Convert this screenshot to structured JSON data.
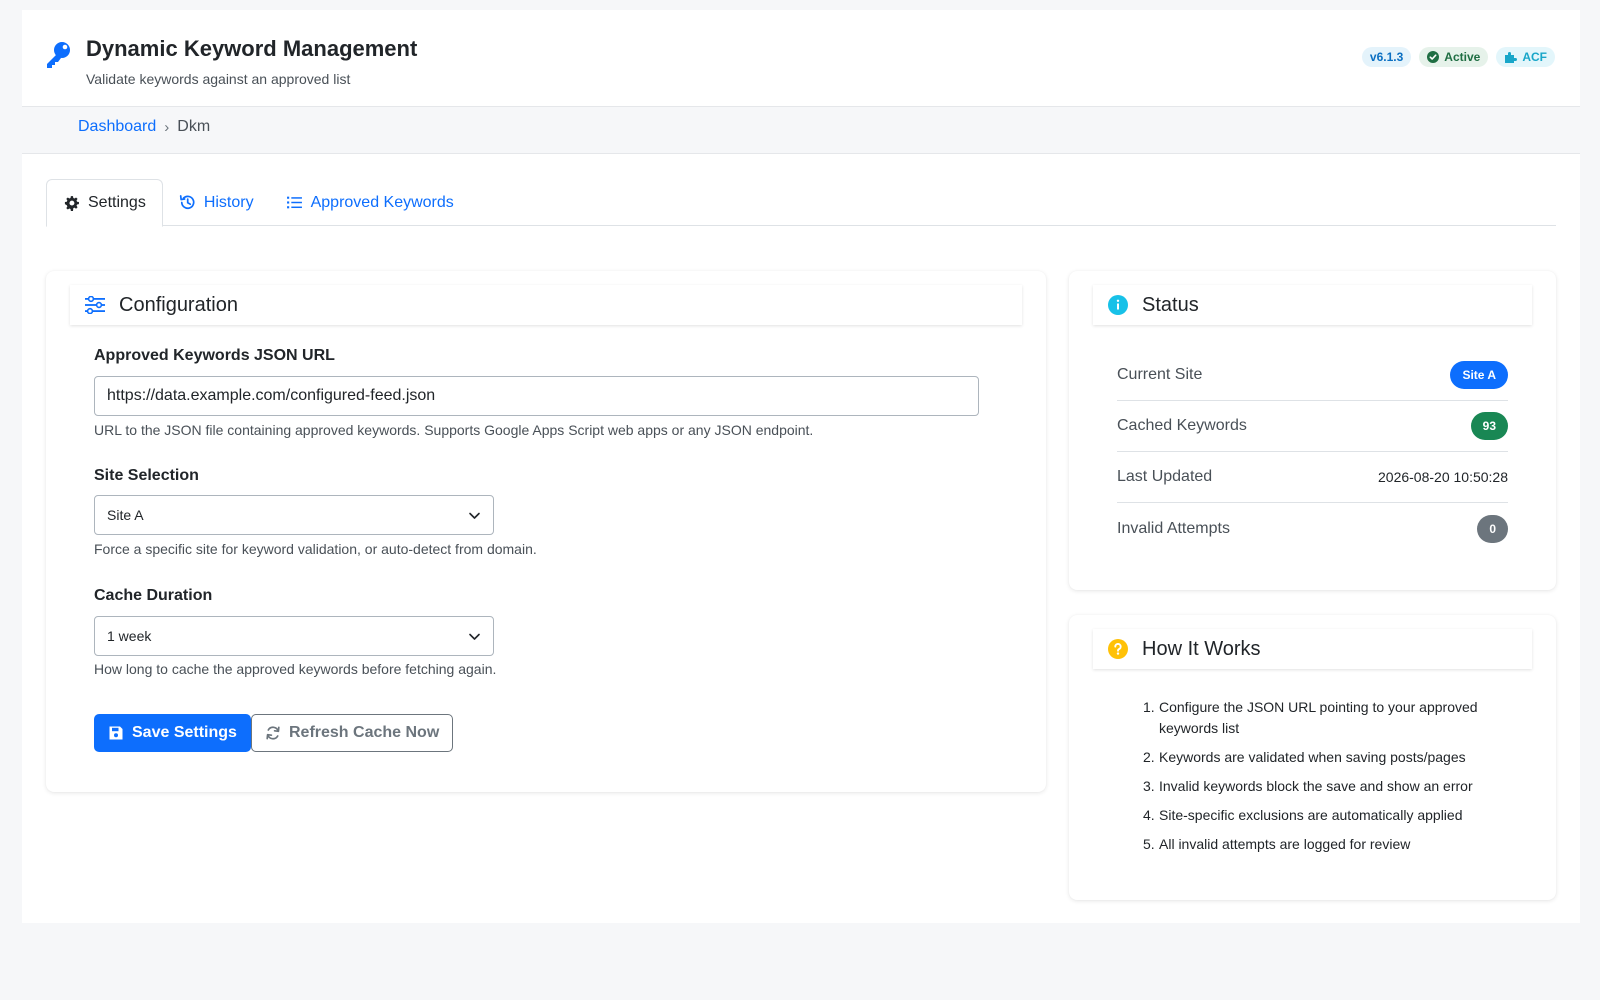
{
  "header": {
    "title": "Dynamic Keyword Management",
    "subtitle": "Validate keywords against an approved list",
    "badges": {
      "version": "v6.1.3",
      "status": "Active",
      "integration": "ACF"
    }
  },
  "breadcrumb": {
    "home": "Dashboard",
    "separator": "›",
    "current": "Dkm"
  },
  "tabs": [
    {
      "label": "Settings",
      "icon": "gear-icon",
      "active": true
    },
    {
      "label": "History",
      "icon": "history-icon",
      "active": false
    },
    {
      "label": "Approved Keywords",
      "icon": "list-icon",
      "active": false
    }
  ],
  "config": {
    "title": "Configuration",
    "json_url": {
      "label": "Approved Keywords JSON URL",
      "value": "https://data.example.com/configured-feed.json",
      "help": "URL to the JSON file containing approved keywords. Supports Google Apps Script web apps or any JSON endpoint."
    },
    "site": {
      "label": "Site Selection",
      "value": "Site A",
      "help": "Force a specific site for keyword validation, or auto-detect from domain."
    },
    "cache": {
      "label": "Cache Duration",
      "value": "1 week",
      "help": "How long to cache the approved keywords before fetching again."
    },
    "save_label": "Save Settings",
    "refresh_label": "Refresh Cache Now"
  },
  "status": {
    "title": "Status",
    "rows": [
      {
        "label": "Current Site",
        "value": "Site A"
      },
      {
        "label": "Cached Keywords",
        "value": "93"
      },
      {
        "label": "Last Updated",
        "value": "2026-08-20 10:50:28"
      },
      {
        "label": "Invalid Attempts",
        "value": "0"
      }
    ]
  },
  "how": {
    "title": "How It Works",
    "steps": [
      "Configure the JSON URL pointing to your approved keywords list",
      "Keywords are validated when saving posts/pages",
      "Invalid keywords block the save and show an error",
      "Site-specific exclusions are automatically applied",
      "All invalid attempts are logged for review"
    ]
  },
  "colors": {
    "primary": "#0d6efd",
    "success": "#198754",
    "secondary": "#6c757d",
    "info": "#17c1e8",
    "warning": "#ffc107"
  }
}
